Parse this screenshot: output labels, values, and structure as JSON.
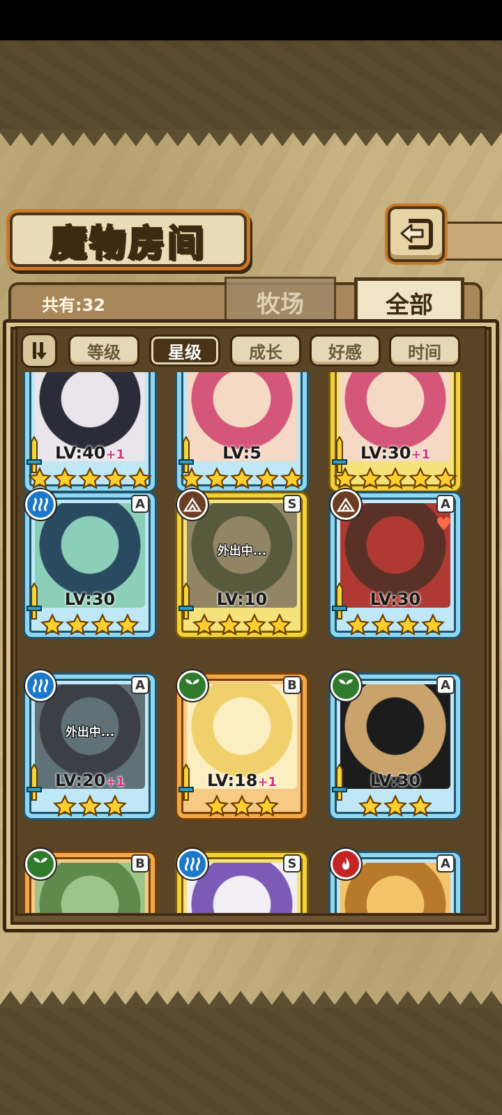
{
  "page": {
    "title": "魔物房间",
    "count_label": "共有:32",
    "tabs": [
      {
        "label": "牧场",
        "active": false
      },
      {
        "label": "全部",
        "active": true
      }
    ]
  },
  "filters": [
    {
      "label": "等级",
      "active": false
    },
    {
      "label": "星级",
      "active": true
    },
    {
      "label": "成长",
      "active": false
    },
    {
      "label": "好感",
      "active": false
    },
    {
      "label": "时间",
      "active": false
    }
  ],
  "cards": [
    {
      "level": "LV:40",
      "plus": "+1",
      "stars": 5,
      "frame": "blue",
      "rank": "",
      "element": "",
      "away": "",
      "palette": [
        "#e9e5ea",
        "#2b2b3a"
      ]
    },
    {
      "level": "LV:5",
      "plus": "",
      "stars": 5,
      "frame": "blue",
      "rank": "",
      "element": "",
      "away": "",
      "palette": [
        "#f6d9c4",
        "#d4577a"
      ]
    },
    {
      "level": "LV:30",
      "plus": "+1",
      "stars": 5,
      "frame": "gold",
      "rank": "",
      "element": "",
      "away": "",
      "palette": [
        "#f6d9c4",
        "#d4577a"
      ]
    },
    {
      "level": "LV:30",
      "plus": "",
      "stars": 4,
      "frame": "blue",
      "rank": "A",
      "element": "water",
      "away": "",
      "palette": [
        "#8ccfb8",
        "#2a4a62"
      ]
    },
    {
      "level": "LV:10",
      "plus": "",
      "stars": 4,
      "frame": "gold",
      "rank": "S",
      "element": "earth",
      "away": "外出中...",
      "palette": [
        "#d9c9a0",
        "#6f7a57"
      ]
    },
    {
      "level": "LV:30",
      "plus": "",
      "stars": 4,
      "frame": "blue",
      "rank": "A",
      "element": "earth",
      "away": "",
      "palette": [
        "#b03a33",
        "#5a3126"
      ]
    },
    {
      "level": "LV:20",
      "plus": "+1",
      "stars": 3,
      "frame": "blue",
      "rank": "A",
      "element": "water",
      "away": "外出中...",
      "palette": [
        "#7fa6c2",
        "#3c4a66"
      ]
    },
    {
      "level": "LV:18",
      "plus": "+1",
      "stars": 3,
      "frame": "orange",
      "rank": "B",
      "element": "leaf",
      "away": "",
      "palette": [
        "#fbeec0",
        "#f0d06a"
      ]
    },
    {
      "level": "LV:30",
      "plus": "",
      "stars": 3,
      "frame": "blue",
      "rank": "A",
      "element": "leaf",
      "away": "",
      "palette": [
        "#1c1c1c",
        "#c9a36b"
      ]
    },
    {
      "level": "",
      "plus": "",
      "stars": 0,
      "frame": "orange",
      "rank": "B",
      "element": "leaf",
      "away": "",
      "palette": [
        "#9fc48a",
        "#5f8a4c"
      ]
    },
    {
      "level": "",
      "plus": "",
      "stars": 0,
      "frame": "gold",
      "rank": "S",
      "element": "water",
      "away": "",
      "palette": [
        "#f1eef4",
        "#7c5bb6"
      ]
    },
    {
      "level": "",
      "plus": "",
      "stars": 0,
      "frame": "blue",
      "rank": "A",
      "element": "fire",
      "away": "",
      "palette": [
        "#f4c46a",
        "#b8792b"
      ]
    }
  ]
}
